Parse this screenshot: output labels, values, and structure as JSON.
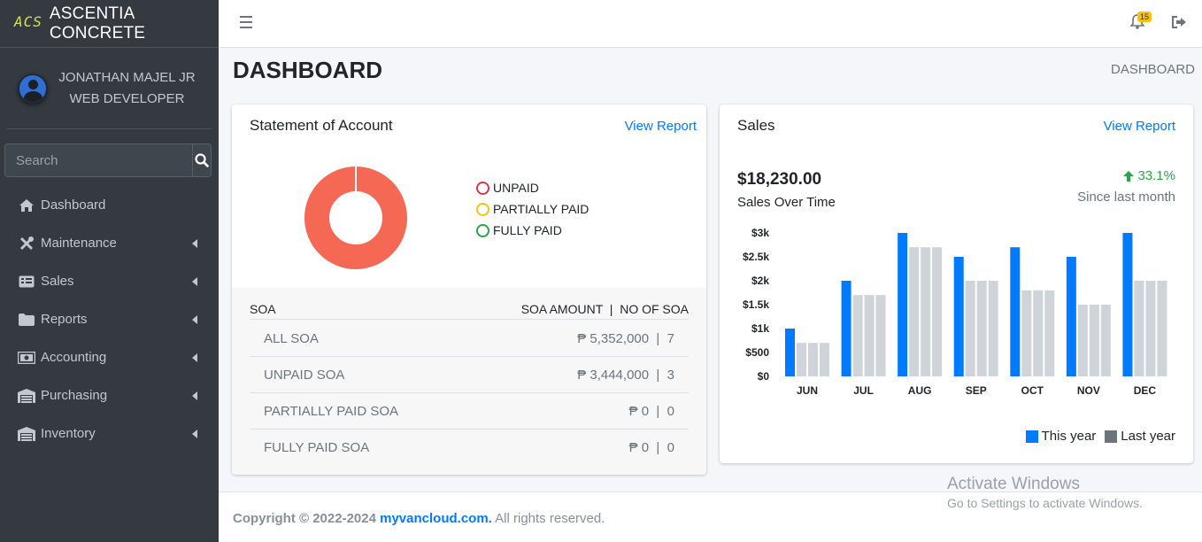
{
  "brand": {
    "logo": "ACS",
    "name": "ASCENTIA CONCRETE"
  },
  "user": {
    "name": "JONATHAN MAJEL JR",
    "role": "WEB DEVELOPER"
  },
  "search": {
    "placeholder": "Search"
  },
  "nav": [
    {
      "label": "Dashboard",
      "icon": "home-icon"
    },
    {
      "label": "Maintenance",
      "icon": "tools-icon"
    },
    {
      "label": "Sales",
      "icon": "invoice-icon"
    },
    {
      "label": "Reports",
      "icon": "folder-icon"
    },
    {
      "label": "Accounting",
      "icon": "money-icon"
    },
    {
      "label": "Purchasing",
      "icon": "warehouse-icon"
    },
    {
      "label": "Inventory",
      "icon": "warehouse-icon"
    }
  ],
  "topbar": {
    "notifications": "15"
  },
  "page": {
    "title": "DASHBOARD",
    "breadcrumb": "DASHBOARD"
  },
  "soa": {
    "title": "Statement of Account",
    "link": "View Report",
    "legend": [
      {
        "label": "UNPAID",
        "color": "#dc3545"
      },
      {
        "label": "PARTIALLY PAID",
        "color": "#ffc107"
      },
      {
        "label": "FULLY PAID",
        "color": "#28a745"
      }
    ],
    "donut_color": "#f56954",
    "header_left": "SOA",
    "header_right": "SOA AMOUNT  |  NO OF SOA",
    "rows": [
      {
        "label": "ALL SOA",
        "value": "₱ 5,352,000  |  7"
      },
      {
        "label": "UNPAID SOA",
        "value": "₱ 3,444,000  |  3"
      },
      {
        "label": "PARTIALLY PAID SOA",
        "value": "₱ 0  |  0"
      },
      {
        "label": "FULLY PAID SOA",
        "value": "₱ 0  |  0"
      }
    ]
  },
  "sales": {
    "title": "Sales",
    "link": "View Report",
    "amount": "$18,230.00",
    "subtitle": "Sales Over Time",
    "change": "33.1%",
    "since": "Since last month",
    "legend_this": "This year",
    "legend_last": "Last year"
  },
  "chart_data": {
    "type": "bar",
    "categories": [
      "JUN",
      "JUL",
      "AUG",
      "SEP",
      "OCT",
      "NOV",
      "DEC"
    ],
    "series": [
      {
        "name": "This year",
        "color": "#007bff",
        "values": [
          1000,
          2000,
          3000,
          2500,
          2700,
          2500,
          3000
        ]
      },
      {
        "name": "Last year",
        "color": "#ced4da",
        "values": [
          700,
          1700,
          2700,
          2000,
          1800,
          1500,
          2000
        ]
      }
    ],
    "yticks": [
      "$0",
      "$500",
      "$1k",
      "$1.5k",
      "$2k",
      "$2.5k",
      "$3k"
    ],
    "ylim": [
      0,
      3000
    ]
  },
  "footer": {
    "copyright": "Copyright © 2022-2024 ",
    "site": "myvancloud.com.",
    "rights": " All rights reserved."
  },
  "watermark": {
    "line1": "Activate Windows",
    "line2": "Go to Settings to activate Windows."
  }
}
